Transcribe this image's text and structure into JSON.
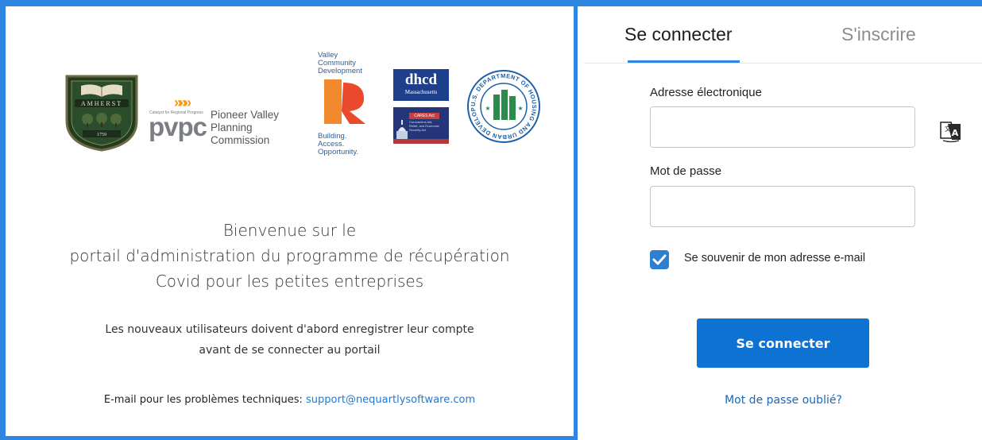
{
  "logos": {
    "amherst": {
      "text": "AMHERST",
      "year": "1759"
    },
    "pvpc": {
      "tagline": "Catalyst for Regional Progress",
      "mark": "pvpc",
      "name": "Pioneer Valley\nPlanning Commission"
    },
    "vcd": {
      "title": "Valley\nCommunity\nDevelopment",
      "tagline": "Building.\nAccess.\nOpportunity."
    },
    "dhcd": {
      "main": "dhcd",
      "sub": "Massachusetts"
    },
    "cares": {
      "label": "CARES Act",
      "sub": "Coronavirus Aid,\nRelief, and Economic\nSecurity Act"
    },
    "hud": {
      "text": "U.S. DEPARTMENT OF HOUSING AND URBAN DEVELOPMENT"
    }
  },
  "welcome": {
    "line1": "Bienvenue sur le",
    "line2": "portail d'administration du programme de récupération",
    "line3": "Covid pour les petites entreprises"
  },
  "notice": {
    "line1": "Les nouveaux utilisateurs doivent d'abord enregistrer leur compte",
    "line2": "avant de se connecter au portail"
  },
  "support": {
    "label": "E-mail pour les problèmes techniques: ",
    "email": "support@nequartlysoftware.com"
  },
  "tabs": {
    "login": "Se connecter",
    "signup": "S'inscrire",
    "active": "login"
  },
  "form": {
    "email_label": "Adresse électronique",
    "email_value": "",
    "password_label": "Mot de passe",
    "password_value": "",
    "remember_label": "Se souvenir de mon adresse e-mail",
    "remember_checked": true,
    "submit_label": "Se connecter",
    "forgot_label": "Mot de passe oublié?"
  },
  "colors": {
    "accent": "#2f86e0",
    "button": "#0d72d2",
    "link": "#2678c8",
    "checkbox": "#2d7fd2"
  },
  "icons": {
    "translate": "translate-icon",
    "checkmark": "checkmark-icon"
  }
}
